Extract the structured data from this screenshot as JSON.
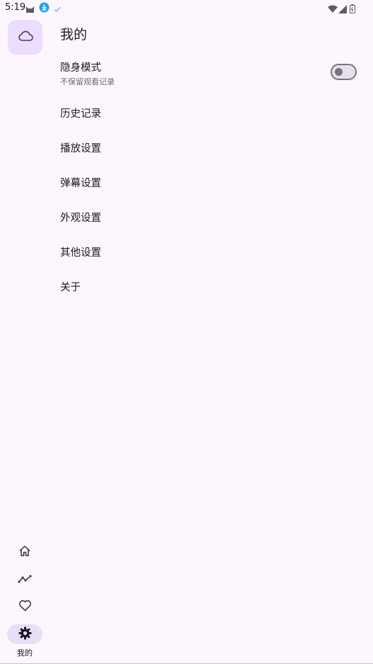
{
  "status_bar": {
    "time": "5:19",
    "icons": [
      "cat-icon",
      "download-icon",
      "check-icon",
      "wifi-icon",
      "signal-icon",
      "battery-icon"
    ]
  },
  "rail": {
    "top_button_icon": "cloud-icon",
    "items": [
      {
        "icon": "home-icon",
        "label": ""
      },
      {
        "icon": "trending-icon",
        "label": ""
      },
      {
        "icon": "heart-icon",
        "label": ""
      },
      {
        "icon": "settings-icon",
        "label": "我的",
        "active": true
      }
    ]
  },
  "main": {
    "title": "我的",
    "incognito": {
      "label": "隐身模式",
      "sublabel": "不保留观看记录",
      "enabled": false
    },
    "menu": [
      {
        "label": "历史记录"
      },
      {
        "label": "播放设置"
      },
      {
        "label": "弹幕设置"
      },
      {
        "label": "外观设置"
      },
      {
        "label": "其他设置"
      },
      {
        "label": "关于"
      }
    ]
  },
  "colors": {
    "background": "#fdf7fd",
    "accent_container": "#eaddff",
    "rail_active": "#e8def8",
    "outline": "#79747e"
  }
}
